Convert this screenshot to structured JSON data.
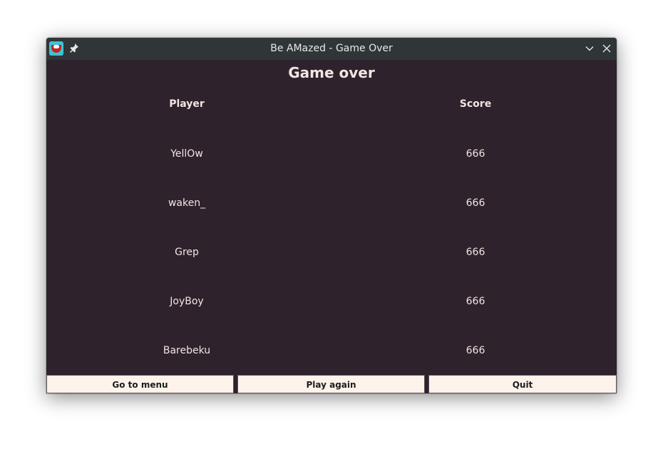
{
  "window": {
    "title": "Be AMazed - Game Over",
    "icons": {
      "app": "app-logo-icon",
      "pin": "pin-icon",
      "minimize": "chevron-down-icon",
      "close": "close-icon"
    }
  },
  "content": {
    "heading": "Game over",
    "columns": {
      "player": "Player",
      "score": "Score"
    },
    "rows": [
      {
        "player": "YellOw",
        "score": "666"
      },
      {
        "player": "waken_",
        "score": "666"
      },
      {
        "player": "Grep",
        "score": "666"
      },
      {
        "player": "JoyBoy",
        "score": "666"
      },
      {
        "player": "Barebeku",
        "score": "666"
      }
    ]
  },
  "buttons": {
    "menu": "Go to menu",
    "play_again": "Play again",
    "quit": "Quit"
  },
  "colors": {
    "background": "#2e222d",
    "titlebar": "#303537",
    "button_bg": "#fdf3ea",
    "app_icon": "#3ec2d8"
  }
}
